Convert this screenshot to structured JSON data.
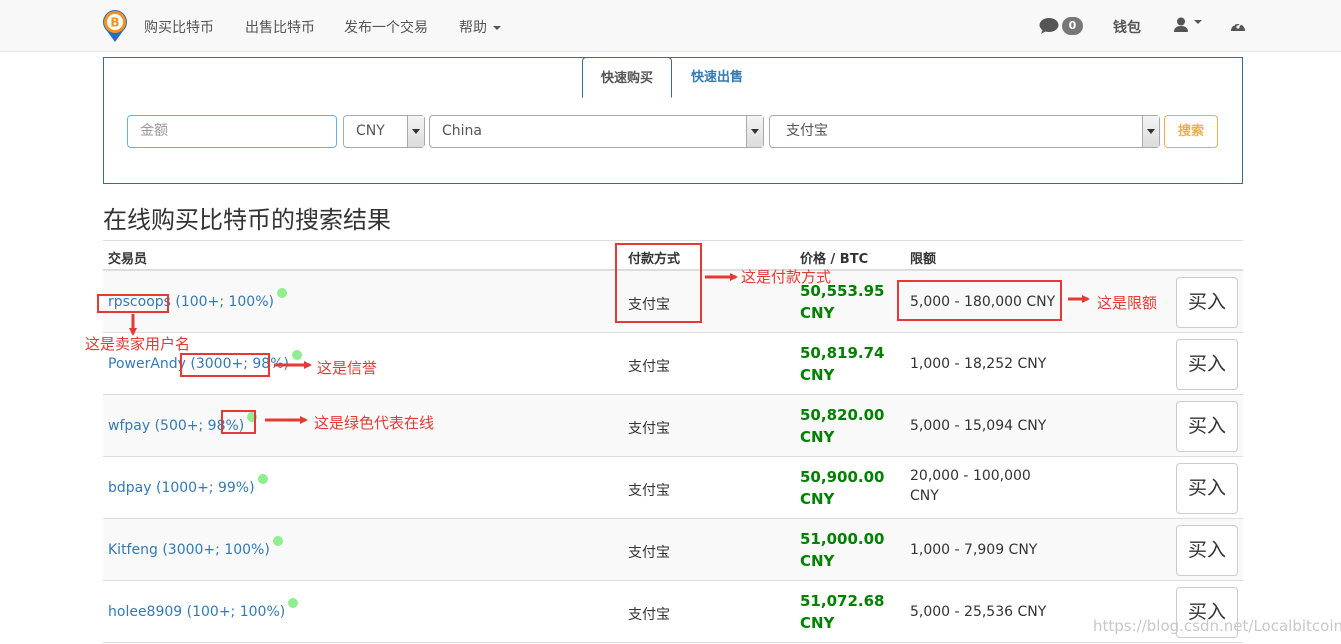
{
  "nav": {
    "links": [
      "购买比特币",
      "出售比特币",
      "发布一个交易",
      "帮助"
    ],
    "message_count": "0",
    "wallet": "钱包"
  },
  "search": {
    "tabs": [
      "快速购买",
      "快速出售"
    ],
    "amount_placeholder": "金额",
    "currency": "CNY",
    "country": "China",
    "payment_method": "支付宝",
    "search_button": "搜索"
  },
  "results": {
    "title": "在线购买比特币的搜索结果",
    "headers": {
      "trader": "交易员",
      "payment": "付款方式",
      "price": "价格 / BTC",
      "limit": "限额"
    },
    "rows": [
      {
        "name": "rpscoops",
        "stats": "(100+; 100%)",
        "payment": "支付宝",
        "price": "50,553.95 CNY",
        "limit": "5,000 - 180,000 CNY",
        "buy": "买入"
      },
      {
        "name": "PowerAndy",
        "stats": "(3000+; 98%)",
        "payment": "支付宝",
        "price": "50,819.74 CNY",
        "limit": "1,000 - 18,252 CNY",
        "buy": "买入"
      },
      {
        "name": "wfpay",
        "stats": "(500+; 98%)",
        "payment": "支付宝",
        "price": "50,820.00 CNY",
        "limit": "5,000 - 15,094 CNY",
        "buy": "买入"
      },
      {
        "name": "bdpay",
        "stats": "(1000+; 99%)",
        "payment": "支付宝",
        "price": "50,900.00 CNY",
        "limit": "20,000 - 100,000 CNY",
        "buy": "买入"
      },
      {
        "name": "Kitfeng",
        "stats": "(3000+; 100%)",
        "payment": "支付宝",
        "price": "51,000.00 CNY",
        "limit": "1,000 - 7,909 CNY",
        "buy": "买入"
      },
      {
        "name": "holee8909",
        "stats": "(100+; 100%)",
        "payment": "支付宝",
        "price": "51,072.68 CNY",
        "limit": "5,000 - 25,536 CNY",
        "buy": "买入"
      }
    ]
  },
  "annotations": {
    "payment_method": "这是付款方式",
    "limit": "这是限额",
    "seller_username": "这是卖家用户名",
    "reputation": "这是信誉",
    "online": "这是绿色代表在线"
  },
  "watermark": "https://blog.csdn.net/Localbitcoins",
  "colors": {
    "price_green": "#008000",
    "link_blue": "#337ab7",
    "annotation_red": "#e53935",
    "search_orange": "#f0ad4e",
    "online_dot": "#90ee90"
  }
}
